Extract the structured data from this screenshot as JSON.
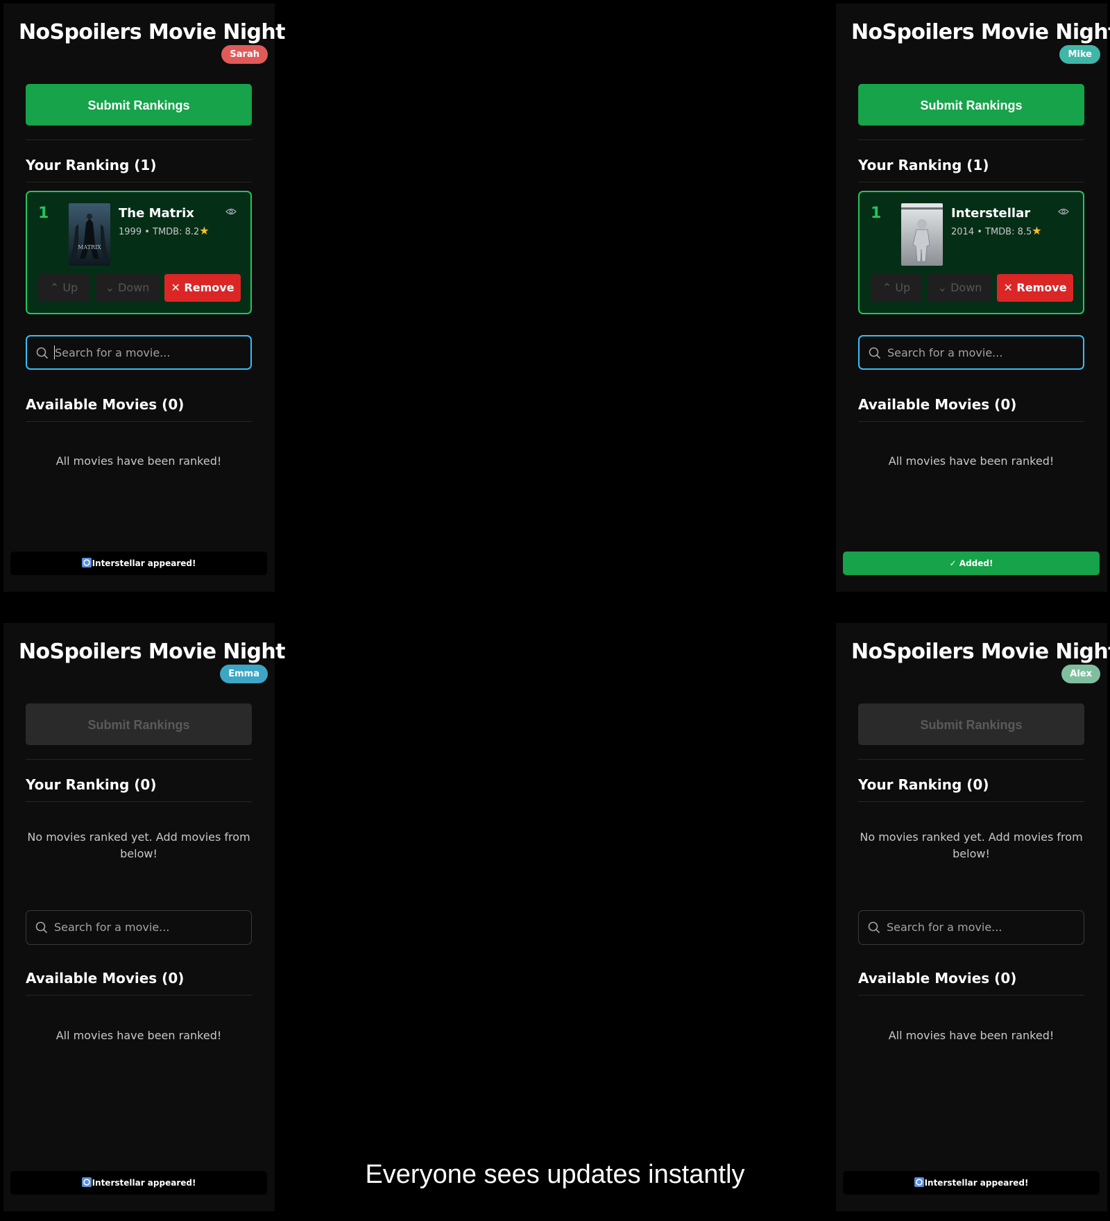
{
  "caption": "Everyone sees updates instantly",
  "colors": {
    "accent_green": "#16a34a",
    "ranking_border": "#22c55e",
    "remove_red": "#dc2626",
    "focus_blue": "#38bdf8"
  },
  "panels": [
    {
      "app_title": "NoSpoilers Movie Night",
      "user": "Sarah",
      "user_color": "#e05a5a",
      "submit_label": "Submit Rankings",
      "submit_enabled": true,
      "ranking_header": "Your Ranking (1)",
      "ranking_empty": "",
      "ranked_movie": {
        "rank": "1",
        "title": "The Matrix",
        "meta": "1999 • TMDB: 8.2",
        "poster_icon": "matrix-poster"
      },
      "buttons": {
        "up": "Up",
        "down": "Down",
        "remove": "Remove"
      },
      "search_placeholder": "Search for a movie...",
      "available_header": "Available Movies (0)",
      "available_empty": "All movies have been ranked!",
      "toast": "Interstellar appeared!",
      "toast_style": "dark"
    },
    {
      "app_title": "NoSpoilers Movie Night",
      "user": "Mike",
      "user_color": "#3fb6a8",
      "submit_label": "Submit Rankings",
      "submit_enabled": true,
      "ranking_header": "Your Ranking (1)",
      "ranking_empty": "",
      "ranked_movie": {
        "rank": "1",
        "title": "Interstellar",
        "meta": "2014 • TMDB: 8.5",
        "poster_icon": "interstellar-poster"
      },
      "buttons": {
        "up": "Up",
        "down": "Down",
        "remove": "Remove"
      },
      "search_placeholder": "Search for a movie...",
      "available_header": "Available Movies (0)",
      "available_empty": "All movies have been ranked!",
      "toast": "✓ Added!",
      "toast_style": "green"
    },
    {
      "app_title": "NoSpoilers Movie Night",
      "user": "Emma",
      "user_color": "#3ca6c4",
      "submit_label": "Submit Rankings",
      "submit_enabled": false,
      "ranking_header": "Your Ranking (0)",
      "ranking_empty": "No movies ranked yet. Add movies from below!",
      "search_placeholder": "Search for a movie...",
      "available_header": "Available Movies (0)",
      "available_empty": "All movies have been ranked!",
      "toast": "Interstellar appeared!",
      "toast_style": "dark"
    },
    {
      "app_title": "NoSpoilers Movie Night",
      "user": "Alex",
      "user_color": "#7fbf9f",
      "submit_label": "Submit Rankings",
      "submit_enabled": false,
      "ranking_header": "Your Ranking (0)",
      "ranking_empty": "No movies ranked yet. Add movies from below!",
      "search_placeholder": "Search for a movie...",
      "available_header": "Available Movies (0)",
      "available_empty": "All movies have been ranked!",
      "toast": "Interstellar appeared!",
      "toast_style": "dark"
    }
  ]
}
